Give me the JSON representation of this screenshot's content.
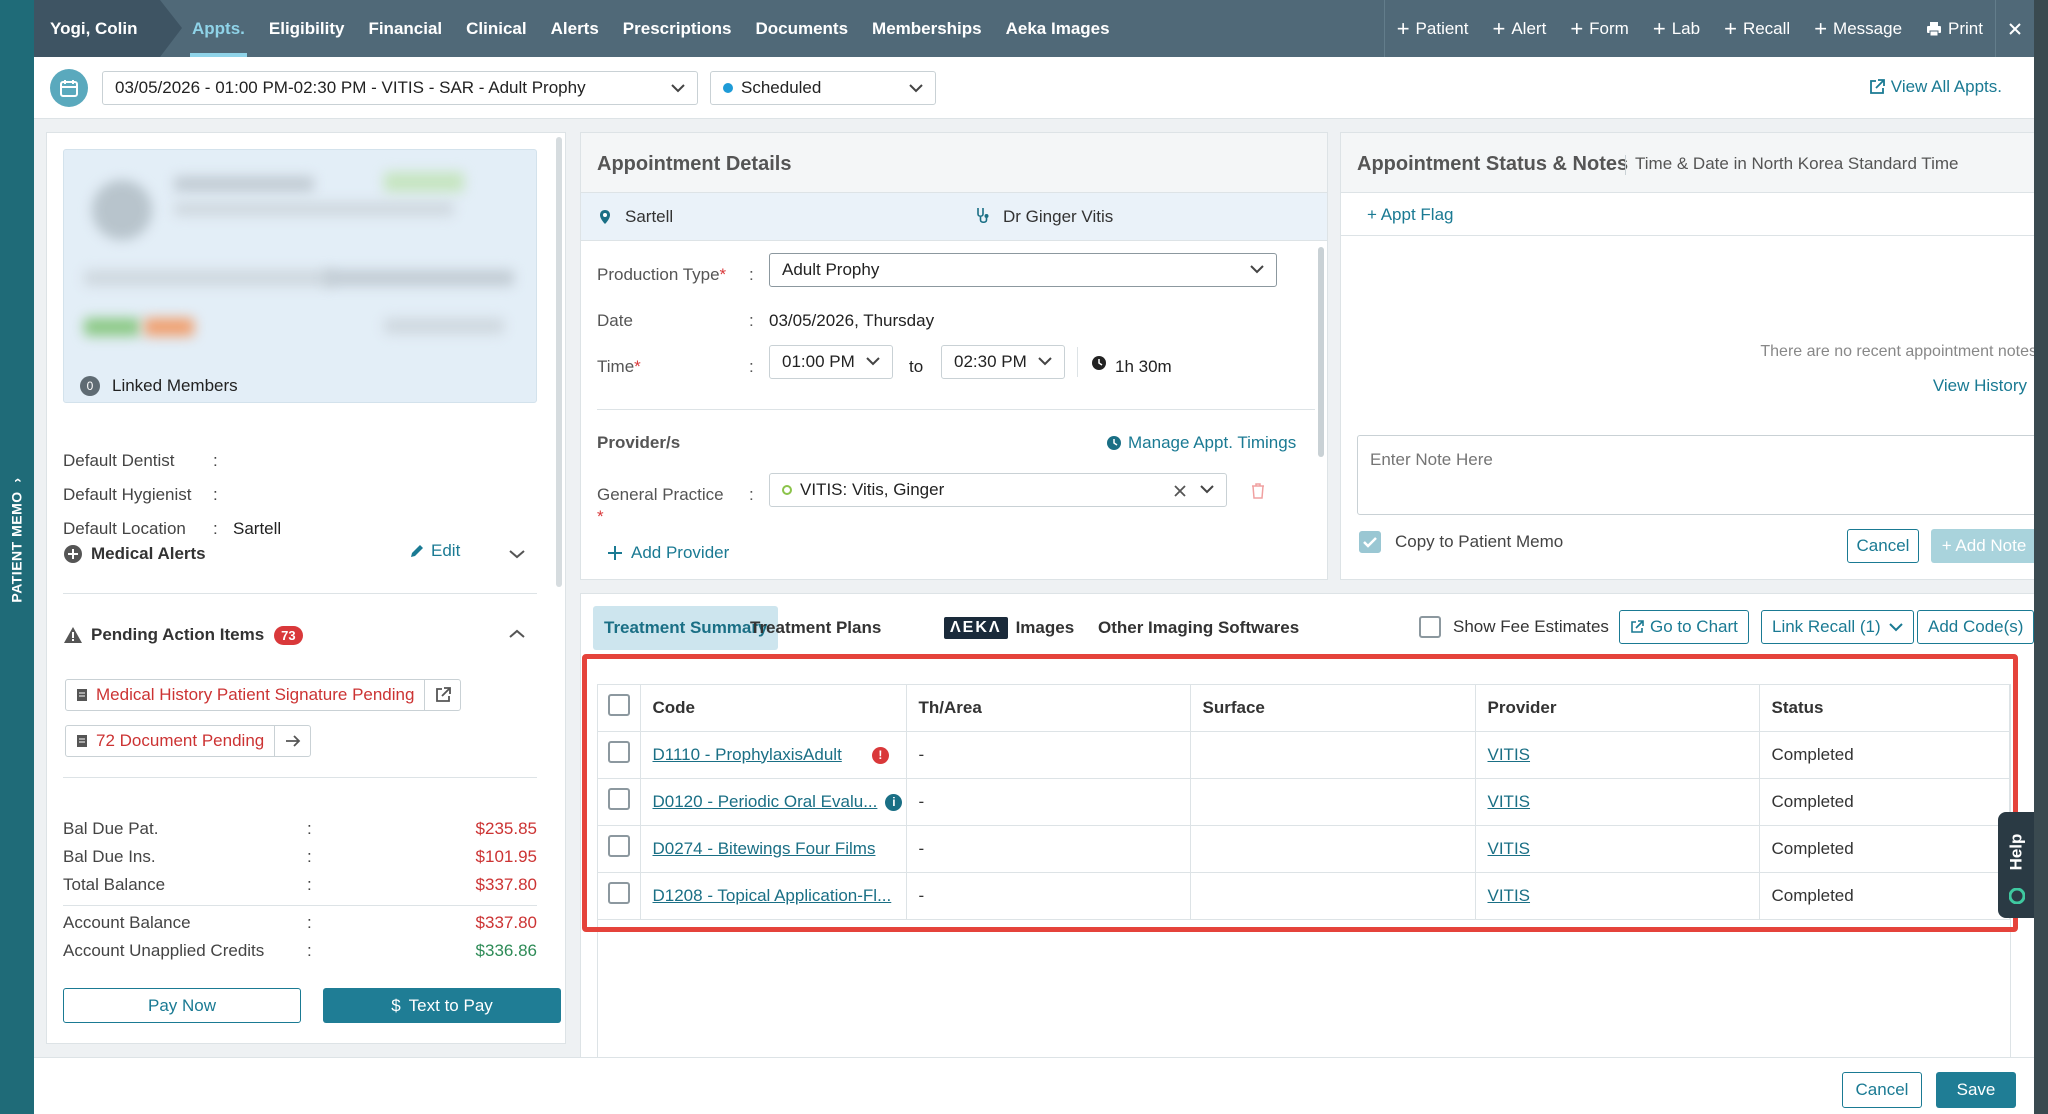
{
  "patient_memo_tab": "PATIENT MEMO",
  "topnav": {
    "patient_name": "Yogi, Colin",
    "tabs": [
      "Appts.",
      "Eligibility",
      "Financial",
      "Clinical",
      "Alerts",
      "Prescriptions",
      "Documents",
      "Memberships",
      "Aeka Images"
    ],
    "active_tab": "Appts.",
    "actions": [
      "Patient",
      "Alert",
      "Form",
      "Lab",
      "Recall",
      "Message"
    ],
    "print": "Print"
  },
  "apptbar": {
    "appointment": "03/05/2026 - 01:00 PM-02:30 PM - VITIS - SAR - Adult Prophy",
    "status": "Scheduled",
    "status_color": "#1e9bd7",
    "view_all": "View All Appts."
  },
  "left": {
    "linked_count": "0",
    "linked_label": "Linked Members",
    "defaults": [
      {
        "label": "Default Dentist",
        "value": ""
      },
      {
        "label": "Default Hygienist",
        "value": ""
      },
      {
        "label": "Default Location",
        "value": "Sartell"
      }
    ],
    "medical_alerts": "Medical Alerts",
    "edit": "Edit",
    "pending_title": "Pending Action Items",
    "pending_count": "73",
    "pending_items": [
      "Medical History Patient Signature Pending",
      "72 Document Pending"
    ],
    "balances": [
      {
        "label": "Bal Due Pat.",
        "amount": "$235.85"
      },
      {
        "label": "Bal Due Ins.",
        "amount": "$101.95"
      },
      {
        "label": "Total Balance",
        "amount": "$337.80"
      },
      {
        "label": "Account Balance",
        "amount": "$337.80"
      },
      {
        "label": "Account Unapplied Credits",
        "amount": "$336.86"
      }
    ],
    "pay_now": "Pay Now",
    "text_to_pay": "Text to Pay"
  },
  "appt_details": {
    "title": "Appointment Details",
    "location": "Sartell",
    "doctor": "Dr Ginger Vitis",
    "production_type_label": "Production Type",
    "production_type": "Adult Prophy",
    "date_label": "Date",
    "date": "03/05/2026, Thursday",
    "time_label": "Time",
    "time_from": "01:00 PM",
    "to": "to",
    "time_to": "02:30 PM",
    "duration": "1h 30m",
    "providers_label": "Provider/s",
    "manage_timings": "Manage Appt. Timings",
    "general_practice_label": "General Practice",
    "provider": "VITIS: Vitis, Ginger",
    "add_provider": "Add Provider"
  },
  "status_notes": {
    "title": "Appointment Status & Notes",
    "subtitle": "Time & Date in North Korea Standard Time",
    "appt_flag": "+ Appt Flag",
    "no_notes": "There are no recent appointment notes",
    "view_history": "View History",
    "note_placeholder": "Enter Note Here",
    "copy_to_memo": "Copy to Patient Memo",
    "cancel": "Cancel",
    "add_note": "+ Add Note"
  },
  "treatment": {
    "tabs": [
      "Treatment Summary",
      "Treatment Plans",
      "Images",
      "Other Imaging Softwares"
    ],
    "aeka_logo": "ΛEKΛ",
    "show_fee": "Show Fee Estimates",
    "go_to_chart": "Go to Chart",
    "link_recall": "Link Recall (1)",
    "add_codes": "Add Code(s)",
    "columns": [
      "Code",
      "Th/Area",
      "Surface",
      "Provider",
      "Status"
    ],
    "rows": [
      {
        "code": "D1110 - ProphylaxisAdult",
        "info": "alert",
        "area": "-",
        "surface": "",
        "provider": "VITIS",
        "status": "Completed"
      },
      {
        "code": "D0120 - Periodic Oral Evalu...",
        "info": "info",
        "area": "-",
        "surface": "",
        "provider": "VITIS",
        "status": "Completed"
      },
      {
        "code": "D0274 - Bitewings Four Films",
        "info": "",
        "area": "-",
        "surface": "",
        "provider": "VITIS",
        "status": "Completed"
      },
      {
        "code": "D1208 - Topical Application-Fl...",
        "info": "",
        "area": "-",
        "surface": "",
        "provider": "VITIS",
        "status": "Completed"
      }
    ]
  },
  "footer": {
    "cancel": "Cancel",
    "save": "Save"
  },
  "help": "Help"
}
